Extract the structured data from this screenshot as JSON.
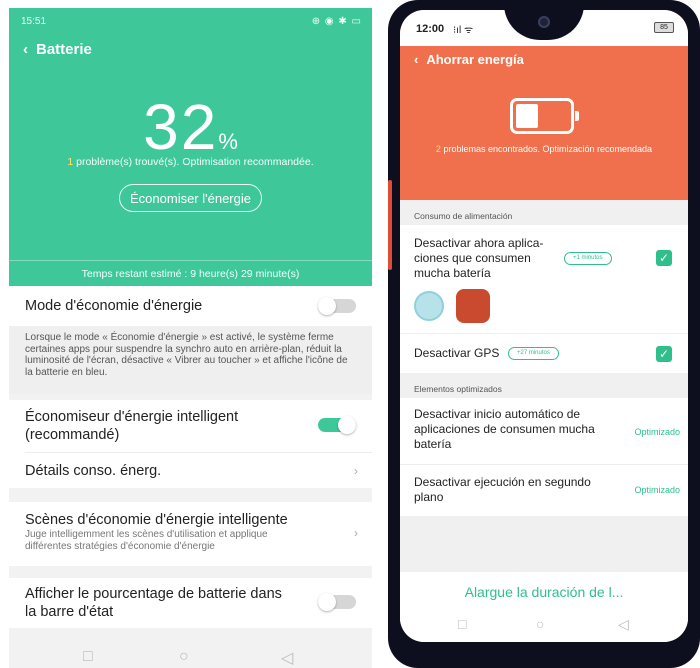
{
  "left": {
    "status": {
      "time": "15:51",
      "icons": "⊕ ◉ ✱ ▭"
    },
    "nav": {
      "back_icon": "back-arrow-icon",
      "title": "Batterie"
    },
    "battery": {
      "value": "32",
      "unit": "%"
    },
    "found": {
      "count": "1",
      "text": " problème(s) trouvé(s). Optimisation recommandée."
    },
    "eco_button": "Économiser l'énergie",
    "remaining": "Temps restant estimé : 9 heure(s) 29 minute(s)",
    "power_mode": {
      "label": "Mode d'économie d'énergie",
      "on": false
    },
    "power_mode_desc": "Lorsque le mode « Économie d'énergie » est activé, le système ferme certaines apps pour suspendre la synchro auto en arrière-plan, réduit la luminosité de l'écran, désactive « Vibrer au toucher » et affiche l'icône de la batterie en bleu.",
    "smart_saver": {
      "label": "Économiseur d'énergie intelligent (recommandé)",
      "on": true
    },
    "details": "Détails conso. énerg.",
    "scenes": {
      "label": "Scènes d'économie d'énergie intelligente",
      "desc": "Juge intelligemment les scènes d'utilisation et applique différentes stratégies d'économie d'énergie"
    },
    "show_percent": {
      "label": "Afficher le pourcentage de batterie dans la barre d'état",
      "on": false
    }
  },
  "right": {
    "status": {
      "time": "12:00",
      "signal": "⁝ıl ᯤ",
      "battery": "85"
    },
    "nav": {
      "title": "Ahorrar energía"
    },
    "problems": {
      "count": "2",
      "text": " problemas encontrados. Optimización recomendada"
    },
    "section_consumption": "Consumo de alimentación",
    "disable_apps": {
      "label": "Desactivar ahora aplica-ciones que consumen mucha batería",
      "pill": "+1 minutos",
      "checked": true
    },
    "disable_gps": {
      "label": "Desactivar GPS",
      "pill": "+27 minutos",
      "checked": true
    },
    "section_optimized": "Elementos optimizados",
    "autostart": {
      "label": "Desactivar inicio automático de aplicaciones de consumen mucha batería",
      "status": "Optimizado"
    },
    "background": {
      "label": "Desactivar ejecución en segundo plano",
      "status": "Optimizado"
    },
    "footer_button": "Alargue la duración de l..."
  },
  "colors": {
    "left_accent": "#3ec89a",
    "right_header": "#f0704d",
    "right_accent": "#2fbf8c"
  }
}
